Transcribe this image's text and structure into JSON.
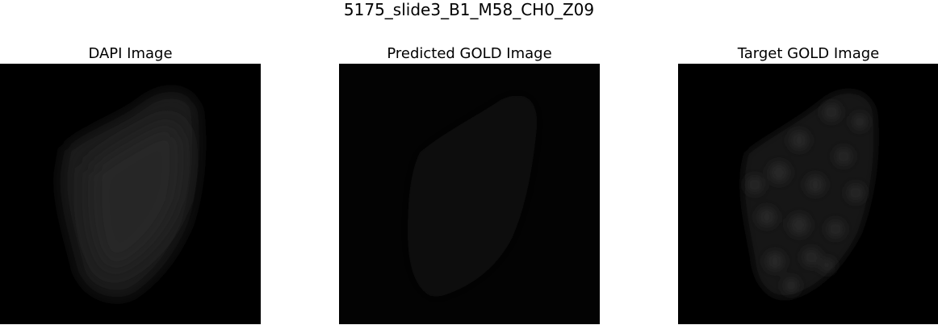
{
  "figure": {
    "title": "5175_slide3_B1_M58_CH0_Z09"
  },
  "panels": [
    {
      "title": "DAPI Image",
      "channel": "dapi",
      "colormap": "grayscale"
    },
    {
      "title": "Predicted GOLD Image",
      "channel": "predicted-gold",
      "colormap": "grayscale"
    },
    {
      "title": "Target GOLD Image",
      "channel": "target-gold",
      "colormap": "grayscale"
    }
  ]
}
